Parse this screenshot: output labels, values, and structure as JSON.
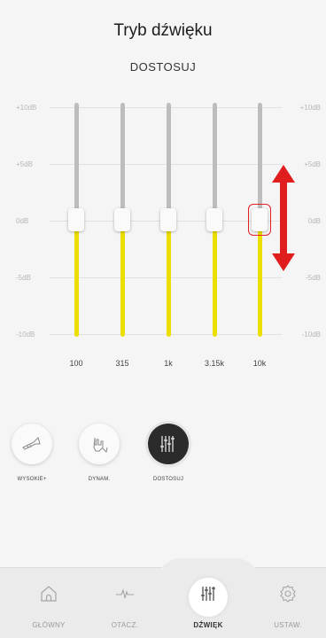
{
  "header": {
    "title": "Tryb dźwięku",
    "subtitle": "DOSTOSUJ"
  },
  "equalizer": {
    "db_labels": [
      "+10dB",
      "+5dB",
      "0dB",
      "-5dB",
      "-10dB"
    ],
    "bands": [
      {
        "freq": "100",
        "gain_db": 0
      },
      {
        "freq": "315",
        "gain_db": 0
      },
      {
        "freq": "1k",
        "gain_db": 0
      },
      {
        "freq": "3.15k",
        "gain_db": 0
      },
      {
        "freq": "10k",
        "gain_db": 0
      }
    ],
    "range_db": [
      -10,
      10
    ],
    "colors": {
      "track_upper": "#bdbdbd",
      "track_lower": "#ecdf00",
      "annotation": "#e02020"
    }
  },
  "modes": [
    {
      "label": "WYSOKIE+",
      "icon": "trumpet-icon",
      "active": false
    },
    {
      "label": "DYNAM.",
      "icon": "hand-rock-icon",
      "active": false
    },
    {
      "label": "DOSTOSUJ",
      "icon": "equalizer-icon",
      "active": true
    }
  ],
  "nav": [
    {
      "label": "GŁÓWNY",
      "icon": "home-icon",
      "active": false
    },
    {
      "label": "OTACZ.",
      "icon": "waveform-icon",
      "active": false
    },
    {
      "label": "DŹWIĘK",
      "icon": "equalizer-icon",
      "active": true
    },
    {
      "label": "USTAW.",
      "icon": "gear-icon",
      "active": false
    }
  ]
}
